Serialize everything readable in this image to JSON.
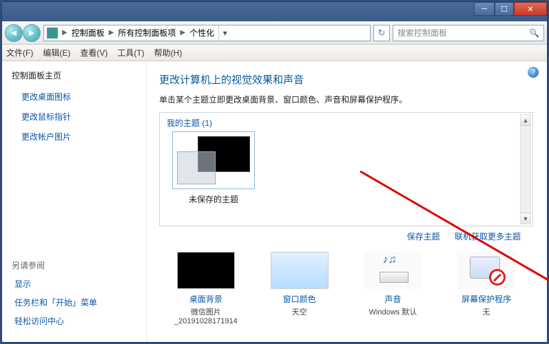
{
  "breadcrumbs": {
    "p0": "控制面板",
    "p1": "所有控制面板项",
    "p2": "个性化"
  },
  "search": {
    "placeholder": "搜索控制面板"
  },
  "menu": {
    "file": "文件(F)",
    "edit": "编辑(E)",
    "view": "查看(V)",
    "tools": "工具(T)",
    "help": "帮助(H)"
  },
  "sidebar": {
    "home": "控制面板主页",
    "links": [
      "更改桌面图标",
      "更改鼠标指针",
      "更改帐户图片"
    ],
    "seealso_head": "另请参阅",
    "seealso": [
      "显示",
      "任务栏和「开始」菜单",
      "轻松访问中心"
    ]
  },
  "content": {
    "heading": "更改计算机上的视觉效果和声音",
    "subtext": "单击某个主题立即更改桌面背景、窗口颜色、声音和屏幕保护程序。",
    "mythemes_label": "我的主题 (1)",
    "theme0": "未保存的主题",
    "save_theme": "保存主题",
    "get_more": "联机获取更多主题"
  },
  "quick": {
    "bg": {
      "name": "桌面背景",
      "value": "微信图片",
      "value2": "_20191028171914"
    },
    "color": {
      "name": "窗口颜色",
      "value": "天空"
    },
    "sound": {
      "name": "声音",
      "value": "Windows 默认"
    },
    "ssaver": {
      "name": "屏幕保护程序",
      "value": "无"
    }
  }
}
